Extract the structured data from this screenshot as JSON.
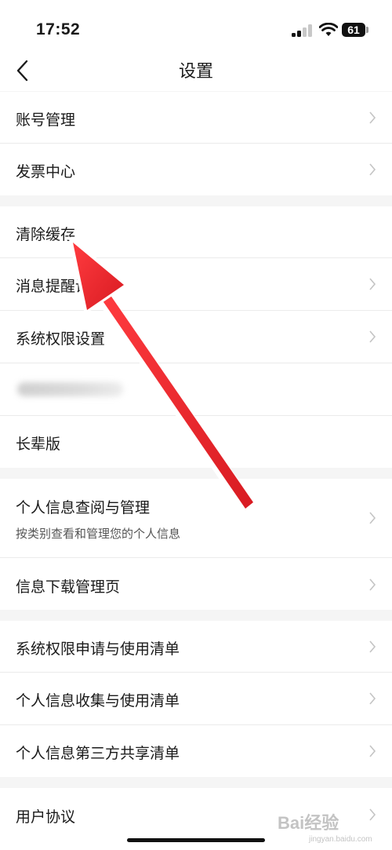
{
  "status_bar": {
    "time": "17:52",
    "battery": "61"
  },
  "nav": {
    "title": "设置"
  },
  "groups": [
    {
      "items": [
        {
          "label": "账号管理"
        },
        {
          "label": "发票中心"
        }
      ]
    },
    {
      "items": [
        {
          "label": "清除缓存"
        },
        {
          "label": "消息提醒设置"
        },
        {
          "label": "系统权限设置"
        },
        {
          "label": ""
        },
        {
          "label": "长辈版"
        }
      ]
    },
    {
      "items": [
        {
          "label": "个人信息查阅与管理",
          "subtitle": "按类别查看和管理您的个人信息"
        },
        {
          "label": "信息下载管理页"
        }
      ]
    },
    {
      "items": [
        {
          "label": "系统权限申请与使用清单"
        },
        {
          "label": "个人信息收集与使用清单"
        },
        {
          "label": "个人信息第三方共享清单"
        }
      ]
    },
    {
      "items": [
        {
          "label": "用户协议"
        }
      ]
    }
  ],
  "annotation": {
    "arrow_color": "#e8262b"
  },
  "watermark": {
    "text": "Bai经验",
    "sub": "jingyan.baidu.com"
  }
}
